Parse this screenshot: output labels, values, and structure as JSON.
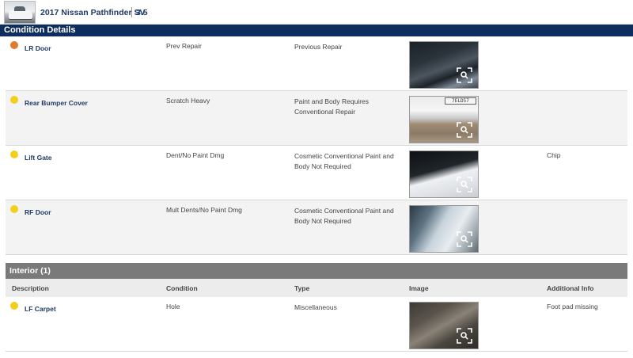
{
  "header": {
    "vehicle_title": "2017 Nissan Pathfinder SV",
    "grade": "3.5"
  },
  "condition_section": {
    "title": "Condition Details",
    "items": [
      {
        "description": "LR Door",
        "condition": "Prev Repair",
        "type": "Previous Repair",
        "additional_info": "",
        "severity_color": "#e07a2e"
      },
      {
        "description": "Rear Bumper Cover",
        "condition": "Scratch Heavy",
        "type": "Paint and Body Requires Conventional Repair",
        "additional_info": "",
        "severity_color": "#f2cf1d"
      },
      {
        "description": "Lift Gate",
        "condition": "Dent/No Paint Dmg",
        "type": "Cosmetic Conventional Paint and Body Not Required",
        "additional_info": "Chip",
        "severity_color": "#f2cf1d"
      },
      {
        "description": "RF Door",
        "condition": "Mult Dents/No Paint Dmg",
        "type": "Cosmetic Conventional Paint and Body Not Required",
        "additional_info": "",
        "severity_color": "#f2cf1d"
      }
    ],
    "plate_text": "7ELD57"
  },
  "interior_section": {
    "title": "Interior (1)",
    "columns": {
      "description": "Description",
      "condition": "Condition",
      "type": "Type",
      "image": "Image",
      "additional_info": "Additional Info"
    },
    "items": [
      {
        "description": "LF Carpet",
        "condition": "Hole",
        "type": "Miscellaneous",
        "additional_info": "Foot pad missing",
        "severity_color": "#f2cf1d"
      }
    ]
  },
  "icons": {
    "zoom": "zoom-expand-icon"
  }
}
